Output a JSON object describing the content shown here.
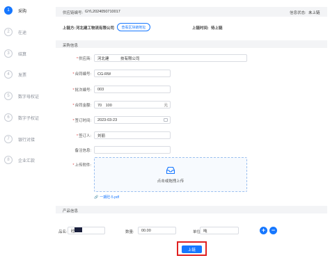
{
  "steps": [
    {
      "num": "1",
      "label": "采购",
      "active": true
    },
    {
      "num": "2",
      "label": "在途"
    },
    {
      "num": "3",
      "label": "结算"
    },
    {
      "num": "4",
      "label": "发票"
    },
    {
      "num": "5",
      "label": "数字母权证"
    },
    {
      "num": "6",
      "label": "数字子权证"
    },
    {
      "num": "7",
      "label": "银行对接"
    },
    {
      "num": "8",
      "label": "企业汇款"
    }
  ],
  "header": {
    "supply_chain_no_label": "供应链编号:",
    "supply_chain_no": "GYL2024050710017",
    "status_label": "信息状态:",
    "status_value": "未上链",
    "uplink_party_label": "上链方:",
    "uplink_party": "河北建工物流有限公司",
    "view_blockchain_button": "查看区块链地址",
    "uplink_time_label": "上链时间:",
    "uplink_time": "待上链"
  },
  "purchase_section": {
    "title": "采购信息",
    "supplier_label": "供应商:",
    "supplier_value": "河北建　　　技有限公司",
    "contract_no_label": "合同编号:",
    "contract_no_value": "CG-RW　　　",
    "batch_no_label": "批次编号:",
    "batch_no_value": "003",
    "contract_amount_label": "合同金额:",
    "contract_amount_value": "70　100",
    "contract_amount_unit": "元",
    "sign_time_label": "签订时间:",
    "sign_time_value": "2023-03-23",
    "signer_label": "签订人:",
    "signer_value": "刘丽",
    "remark_label": "备注信息:",
    "remark_value": "",
    "attachment_label": "上传附件:",
    "upload_hint": "点击或拖拽上传",
    "attached_file": "一期砼-5.pdf"
  },
  "product_section": {
    "title": "产品信息",
    "product_label": "品名:",
    "product_value": "砼",
    "quantity_label": "数量:",
    "quantity_value": "00.00",
    "unit_label": "单位:",
    "unit_value": "吨",
    "add_icon": "+",
    "remove_icon": "−"
  },
  "submit_button": "上链",
  "colors": {
    "primary": "#1677ff",
    "required": "#e03e3e",
    "highlight_border": "#e02020",
    "dark_block": "#1a1f3c"
  }
}
